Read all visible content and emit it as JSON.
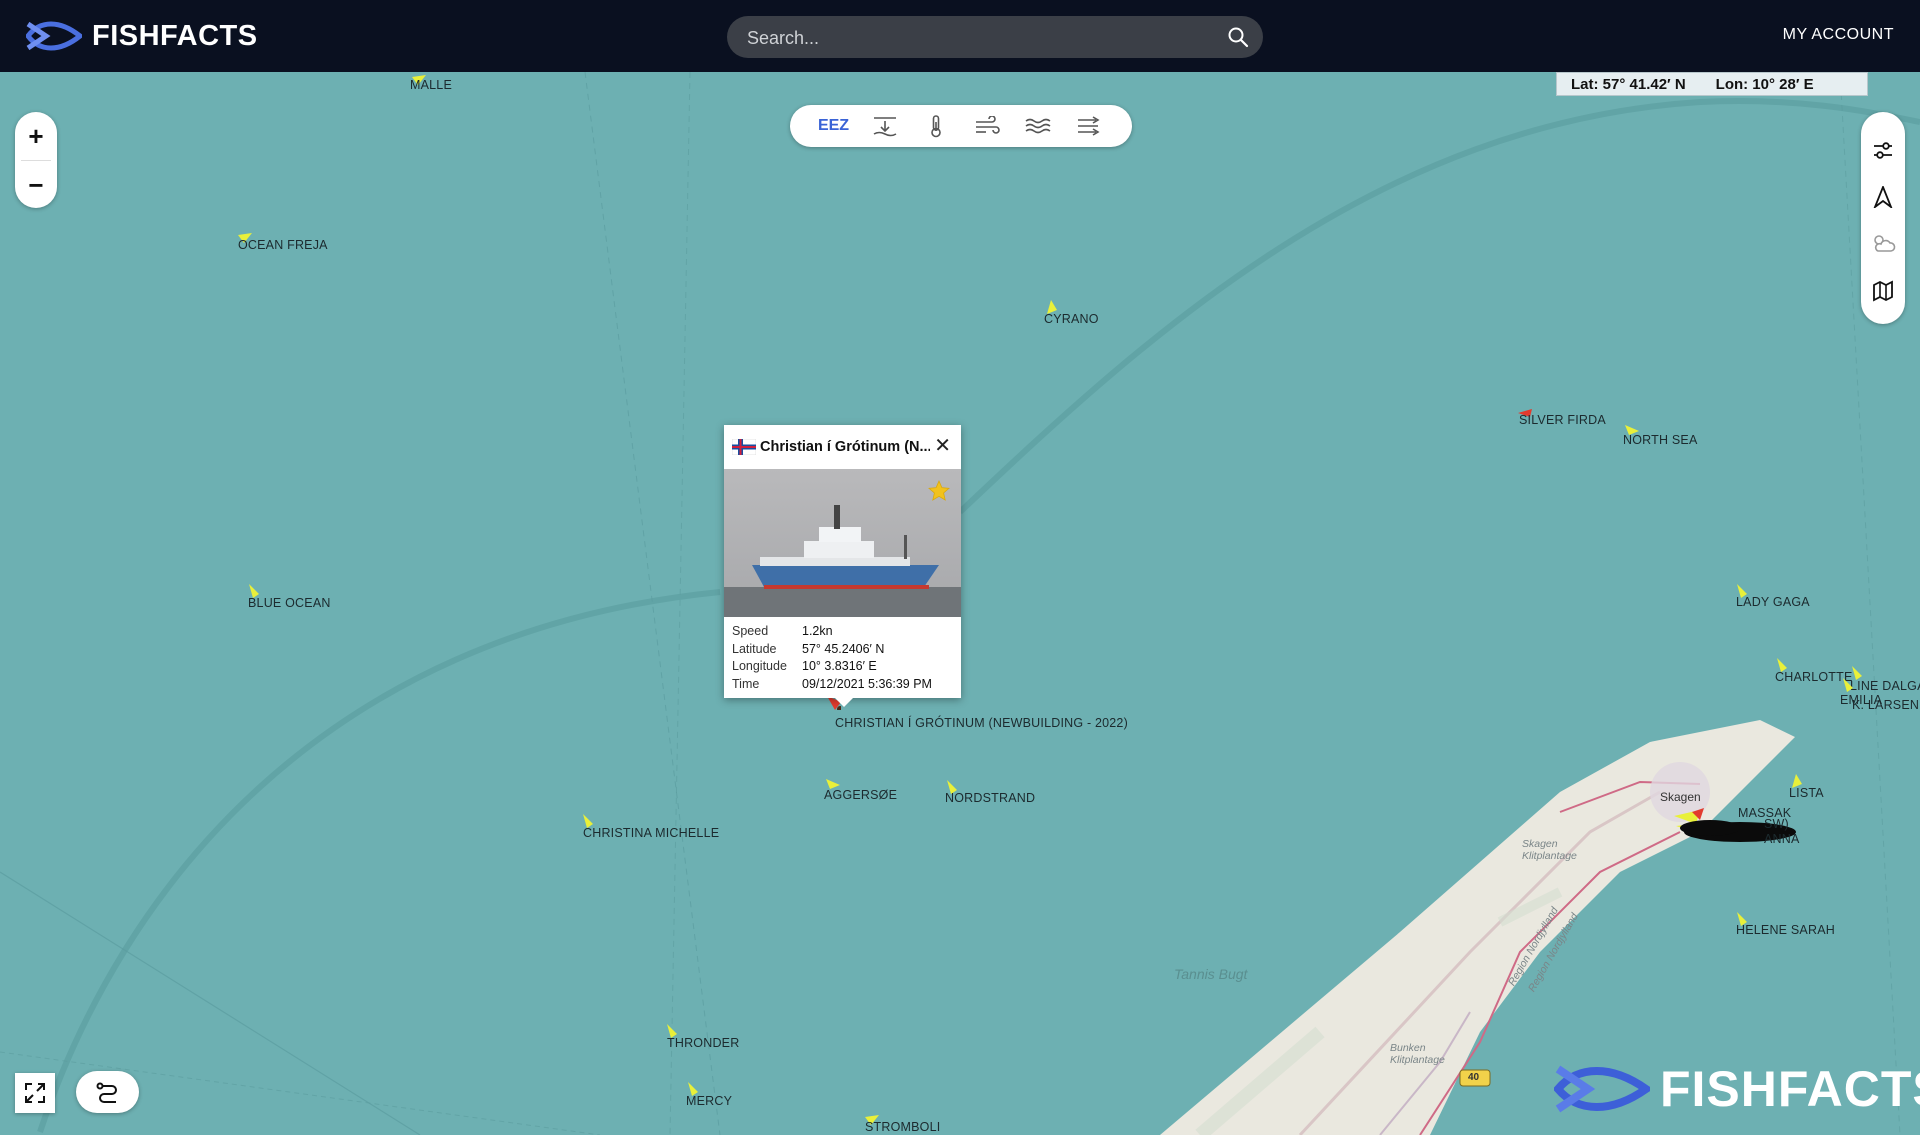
{
  "header": {
    "brand": "FISHFACTS",
    "search_placeholder": "Search...",
    "account_label": "MY ACCOUNT"
  },
  "coords": {
    "lat": "Lat: 57° 41.42′ N",
    "lon": "Lon: 10° 28′ E"
  },
  "zoom": {
    "in": "+",
    "out": "−"
  },
  "layers": {
    "eez": "EEZ",
    "icons": [
      "depth-icon",
      "thermometer-icon",
      "wind-icon",
      "waves-icon",
      "current-icon"
    ]
  },
  "rightbar": {
    "icons": [
      "sliders-icon",
      "navigation-icon",
      "weather-icon",
      "map-icon"
    ]
  },
  "vessels": [
    {
      "name": "MALLE",
      "color": "yellow"
    },
    {
      "name": "OCEAN FREJA",
      "color": "yellow"
    },
    {
      "name": "CYRANO",
      "color": "yellow"
    },
    {
      "name": "SILVER FIRDA",
      "color": "red"
    },
    {
      "name": "NORTH SEA",
      "color": "yellow"
    },
    {
      "name": "BLUE OCEAN",
      "color": "yellow"
    },
    {
      "name": "LADY GAGA",
      "color": "yellow"
    },
    {
      "name": "CHARLOTTE",
      "color": "yellow"
    },
    {
      "name": "LINE DALGAARD",
      "color": "yellow"
    },
    {
      "name": "EMILIA",
      "color": "yellow"
    },
    {
      "name": "K. LARSEN",
      "color": "yellow"
    },
    {
      "name": "CHRISTIAN Í GRÓTINUM (NEWBUILDING - 2022)",
      "color": "red"
    },
    {
      "name": "AGGERSØE",
      "color": "yellow"
    },
    {
      "name": "NORDSTRAND",
      "color": "yellow"
    },
    {
      "name": "LISTA",
      "color": "yellow"
    },
    {
      "name": "CHRISTINA MICHELLE",
      "color": "yellow"
    },
    {
      "name": "HELENE SARAH",
      "color": "yellow"
    },
    {
      "name": "THRONDER",
      "color": "yellow"
    },
    {
      "name": "MERCY",
      "color": "yellow"
    },
    {
      "name": "STROMBOLI",
      "color": "yellow"
    },
    {
      "name": "MASSAK",
      "color": "yellow"
    },
    {
      "name": "SW)",
      "color": "yellow"
    },
    {
      "name": "ANNA",
      "color": "yellow"
    }
  ],
  "places": {
    "skagen": "Skagen",
    "skagen_klit": "Skagen Klitplantage",
    "bunken": "Bunken Klitplantage",
    "tannis": "Tannis Bugt",
    "region1": "Region Nordjylland",
    "region2": "Region Nordjylland",
    "road": "40"
  },
  "popup": {
    "title": "Christian í Grótinum (N...",
    "rows": [
      {
        "k": "Speed",
        "v": "1.2kn"
      },
      {
        "k": "Latitude",
        "v": "57° 45.2406′ N"
      },
      {
        "k": "Longitude",
        "v": "10° 3.8316′ E"
      },
      {
        "k": "Time",
        "v": "09/12/2021 5:36:39 PM"
      }
    ],
    "favorite": true
  },
  "watermark": "FISHFACTS",
  "colors": {
    "topbar": "#0a1020",
    "sea": "#6db0b2",
    "accent": "#3a63d6",
    "vessel_yellow": "#e9f03a",
    "vessel_red": "#e23b2e"
  }
}
